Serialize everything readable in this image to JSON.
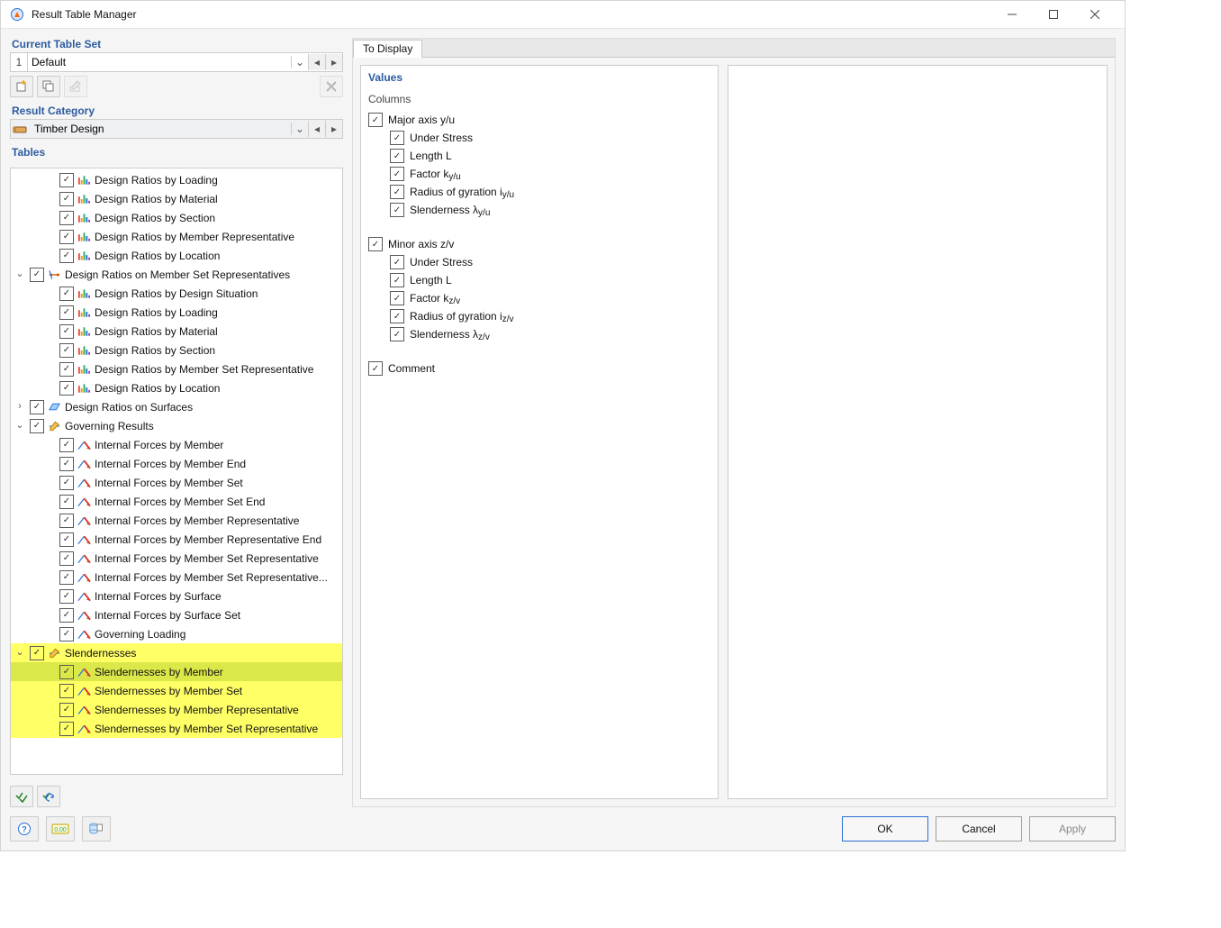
{
  "window_title": "Result Table Manager",
  "sections": {
    "table_set_title": "Current Table Set",
    "result_category_title": "Result Category",
    "tables_title": "Tables"
  },
  "table_set": {
    "index": "1",
    "name": "Default"
  },
  "result_category": {
    "name": "Timber Design"
  },
  "tree": [
    {
      "level": 2,
      "icon": "ratio",
      "label": "Design Ratios by Loading"
    },
    {
      "level": 2,
      "icon": "ratio",
      "label": "Design Ratios by Material"
    },
    {
      "level": 2,
      "icon": "ratio",
      "label": "Design Ratios by Section"
    },
    {
      "level": 2,
      "icon": "ratio",
      "label": "Design Ratios by Member Representative"
    },
    {
      "level": 2,
      "icon": "ratio",
      "label": "Design Ratios by Location"
    },
    {
      "level": 1,
      "icon": "node",
      "label": "Design Ratios on Member Set Representatives",
      "expander": "∨"
    },
    {
      "level": 2,
      "icon": "ratio",
      "label": "Design Ratios by Design Situation"
    },
    {
      "level": 2,
      "icon": "ratio",
      "label": "Design Ratios by Loading"
    },
    {
      "level": 2,
      "icon": "ratio",
      "label": "Design Ratios by Material"
    },
    {
      "level": 2,
      "icon": "ratio",
      "label": "Design Ratios by Section"
    },
    {
      "level": 2,
      "icon": "ratio",
      "label": "Design Ratios by Member Set Representative"
    },
    {
      "level": 2,
      "icon": "ratio",
      "label": "Design Ratios by Location"
    },
    {
      "level": 1,
      "icon": "surface",
      "label": "Design Ratios on Surfaces",
      "expander": "›"
    },
    {
      "level": 1,
      "icon": "pen",
      "label": "Governing Results",
      "expander": "∨"
    },
    {
      "level": 2,
      "icon": "force",
      "label": "Internal Forces by Member"
    },
    {
      "level": 2,
      "icon": "force",
      "label": "Internal Forces by Member End"
    },
    {
      "level": 2,
      "icon": "force",
      "label": "Internal Forces by Member Set"
    },
    {
      "level": 2,
      "icon": "force",
      "label": "Internal Forces by Member Set End"
    },
    {
      "level": 2,
      "icon": "force",
      "label": "Internal Forces by Member Representative"
    },
    {
      "level": 2,
      "icon": "force",
      "label": "Internal Forces by Member Representative End"
    },
    {
      "level": 2,
      "icon": "force",
      "label": "Internal Forces by Member Set Representative"
    },
    {
      "level": 2,
      "icon": "force",
      "label": "Internal Forces by Member Set Representative..."
    },
    {
      "level": 2,
      "icon": "force",
      "label": "Internal Forces by Surface"
    },
    {
      "level": 2,
      "icon": "force",
      "label": "Internal Forces by Surface Set"
    },
    {
      "level": 2,
      "icon": "force",
      "label": "Governing Loading"
    },
    {
      "level": 1,
      "icon": "pen",
      "label": "Slendernesses",
      "expander": "∨",
      "hl": true
    },
    {
      "level": 2,
      "icon": "force",
      "label": "Slendernesses by Member",
      "hl": true,
      "selected": true
    },
    {
      "level": 2,
      "icon": "force",
      "label": "Slendernesses by Member Set",
      "hl": true
    },
    {
      "level": 2,
      "icon": "force",
      "label": "Slendernesses by Member Representative",
      "hl": true
    },
    {
      "level": 2,
      "icon": "force",
      "label": "Slendernesses by Member Set Representative",
      "hl": true
    }
  ],
  "right_panel": {
    "tab": "To Display",
    "values_title": "Values",
    "columns_label": "Columns",
    "groups": [
      {
        "label_html": "Major axis y/u",
        "children": [
          "Under Stress",
          "Length L",
          "Factor k<sub>y/u</sub>",
          "Radius of gyration i<sub>y/u</sub>",
          "Slenderness λ<sub>y/u</sub>"
        ]
      },
      {
        "label_html": "Minor axis z/v",
        "children": [
          "Under Stress",
          "Length L",
          "Factor k<sub>z/v</sub>",
          "Radius of gyration i<sub>z/v</sub>",
          "Slenderness λ<sub>z/v</sub>"
        ]
      },
      {
        "label_html": "Comment",
        "children": []
      }
    ]
  },
  "footer": {
    "ok": "OK",
    "cancel": "Cancel",
    "apply": "Apply"
  }
}
